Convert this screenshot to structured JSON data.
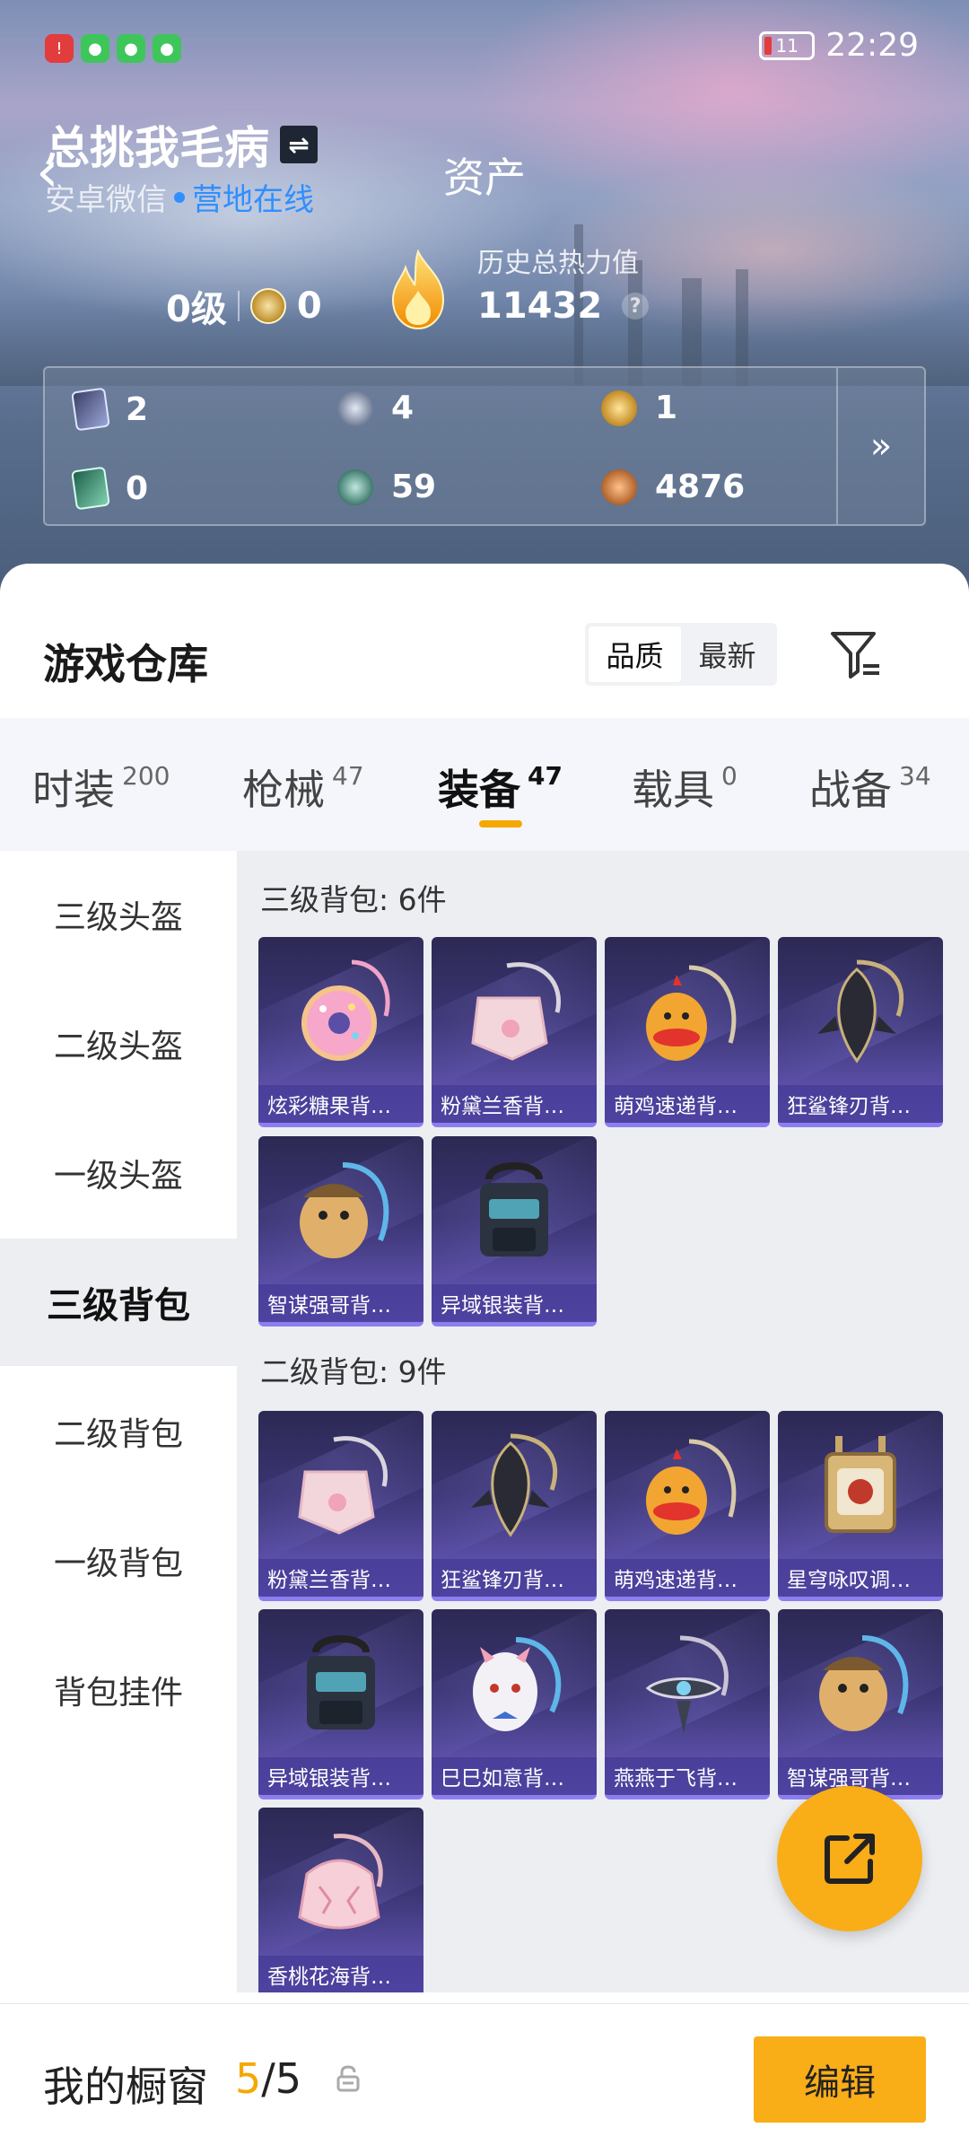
{
  "status_bar": {
    "time": "22:29",
    "battery": "11"
  },
  "header": {
    "username": "总挑我毛病",
    "login_method": "安卓微信",
    "online_status": "营地在线",
    "page_title": "资产",
    "level": "0级",
    "medal_count": "0",
    "heat_label": "历史总热力值",
    "heat_value": "11432"
  },
  "assets": {
    "items": [
      {
        "icon": "purple-card-icon",
        "value": "2"
      },
      {
        "icon": "silver-coin-icon",
        "value": "4"
      },
      {
        "icon": "gold-coin-icon",
        "value": "1"
      },
      {
        "icon": "green-card-icon",
        "value": "0"
      },
      {
        "icon": "teal-coin-icon",
        "value": "59"
      },
      {
        "icon": "bronze-coin-icon",
        "value": "4876"
      }
    ],
    "more": "»"
  },
  "warehouse": {
    "title": "游戏仓库",
    "sort_options": [
      "品质",
      "最新"
    ],
    "active_sort": "品质"
  },
  "tabs": [
    {
      "label": "时装",
      "count": "200"
    },
    {
      "label": "枪械",
      "count": "47"
    },
    {
      "label": "装备",
      "count": "47",
      "active": true
    },
    {
      "label": "载具",
      "count": "0"
    },
    {
      "label": "战备",
      "count": "34"
    }
  ],
  "sidebar": {
    "items": [
      "三级头盔",
      "二级头盔",
      "一级头盔",
      "三级背包",
      "二级背包",
      "一级背包",
      "背包挂件"
    ],
    "active": "三级背包"
  },
  "sections": [
    {
      "title": "三级背包: 6件",
      "items": [
        "炫彩糖果背…",
        "粉黛兰香背…",
        "萌鸡速递背…",
        "狂鲨锋刃背…",
        "智谋强哥背…",
        "异域银装背…"
      ]
    },
    {
      "title": "二级背包: 9件",
      "items": [
        "粉黛兰香背…",
        "狂鲨锋刃背…",
        "萌鸡速递背…",
        "星穹咏叹调…",
        "异域银装背…",
        "巳巳如意背…",
        "燕燕于飞背…",
        "智谋强哥背…",
        "香桃花海背…"
      ]
    }
  ],
  "bottom_bar": {
    "label": "我的橱窗",
    "count_current": "5",
    "count_total": "/5",
    "edit_label": "编辑"
  },
  "colors": {
    "accent": "#f9ad17",
    "online": "#2f8fff",
    "card": "#3b3573"
  }
}
